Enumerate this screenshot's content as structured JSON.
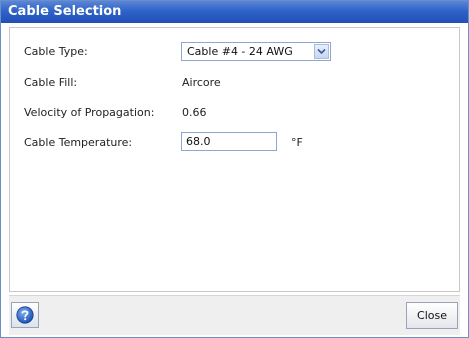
{
  "dialog": {
    "title": "Cable Selection"
  },
  "fields": {
    "cable_type": {
      "label": "Cable Type:",
      "selected": "Cable #4 - 24 AWG"
    },
    "cable_fill": {
      "label": "Cable Fill:",
      "value": "Aircore"
    },
    "velocity": {
      "label": "Velocity of Propagation:",
      "value": "0.66"
    },
    "temperature": {
      "label": "Cable Temperature:",
      "value": "68.0",
      "unit": "°F"
    }
  },
  "footer": {
    "help_icon": "question-mark-circle-icon",
    "close_label": "Close"
  },
  "colors": {
    "titlebar": "#2f63c8",
    "help_icon": "#2a62c4"
  }
}
